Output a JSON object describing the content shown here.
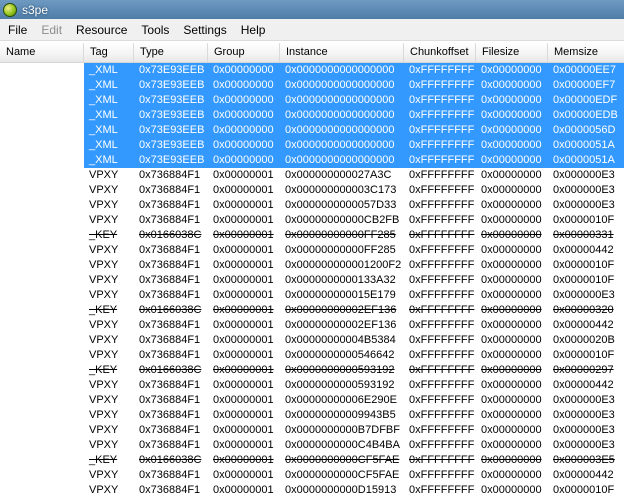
{
  "window": {
    "title": "s3pe",
    "icon": "app-globe-icon"
  },
  "menu": [
    {
      "label": "File",
      "enabled": true
    },
    {
      "label": "Edit",
      "enabled": false
    },
    {
      "label": "Resource",
      "enabled": true
    },
    {
      "label": "Tools",
      "enabled": true
    },
    {
      "label": "Settings",
      "enabled": true
    },
    {
      "label": "Help",
      "enabled": true
    }
  ],
  "columns": [
    "Name",
    "Tag",
    "Type",
    "Group",
    "Instance",
    "Chunkoffset",
    "Filesize",
    "Memsize"
  ],
  "rows": [
    {
      "name": "",
      "tag": "_XML",
      "type": "0x73E93EEB",
      "group": "0x00000000",
      "instance": "0x0000000000000000",
      "chunk": "0xFFFFFFFF",
      "filesize": "0x00000000",
      "memsize": "0x00000EE7",
      "selected": true,
      "deleted": false
    },
    {
      "name": "",
      "tag": "_XML",
      "type": "0x73E93EEB",
      "group": "0x00000000",
      "instance": "0x0000000000000000",
      "chunk": "0xFFFFFFFF",
      "filesize": "0x00000000",
      "memsize": "0x00000EF7",
      "selected": true,
      "deleted": false
    },
    {
      "name": "",
      "tag": "_XML",
      "type": "0x73E93EEB",
      "group": "0x00000000",
      "instance": "0x0000000000000000",
      "chunk": "0xFFFFFFFF",
      "filesize": "0x00000000",
      "memsize": "0x00000EDF",
      "selected": true,
      "deleted": false
    },
    {
      "name": "",
      "tag": "_XML",
      "type": "0x73E93EEB",
      "group": "0x00000000",
      "instance": "0x0000000000000000",
      "chunk": "0xFFFFFFFF",
      "filesize": "0x00000000",
      "memsize": "0x00000EDB",
      "selected": true,
      "deleted": false
    },
    {
      "name": "",
      "tag": "_XML",
      "type": "0x73E93EEB",
      "group": "0x00000000",
      "instance": "0x0000000000000000",
      "chunk": "0xFFFFFFFF",
      "filesize": "0x00000000",
      "memsize": "0x0000056D",
      "selected": true,
      "deleted": false
    },
    {
      "name": "",
      "tag": "_XML",
      "type": "0x73E93EEB",
      "group": "0x00000000",
      "instance": "0x0000000000000000",
      "chunk": "0xFFFFFFFF",
      "filesize": "0x00000000",
      "memsize": "0x0000051A",
      "selected": true,
      "deleted": false
    },
    {
      "name": "",
      "tag": "_XML",
      "type": "0x73E93EEB",
      "group": "0x00000000",
      "instance": "0x0000000000000000",
      "chunk": "0xFFFFFFFF",
      "filesize": "0x00000000",
      "memsize": "0x0000051A",
      "selected": true,
      "deleted": false
    },
    {
      "name": "",
      "tag": "VPXY",
      "type": "0x736884F1",
      "group": "0x00000001",
      "instance": "0x000000000027A3C",
      "chunk": "0xFFFFFFFF",
      "filesize": "0x00000000",
      "memsize": "0x000000E3",
      "selected": false,
      "deleted": false
    },
    {
      "name": "",
      "tag": "VPXY",
      "type": "0x736884F1",
      "group": "0x00000001",
      "instance": "0x000000000003C173",
      "chunk": "0xFFFFFFFF",
      "filesize": "0x00000000",
      "memsize": "0x000000E3",
      "selected": false,
      "deleted": false
    },
    {
      "name": "",
      "tag": "VPXY",
      "type": "0x736884F1",
      "group": "0x00000001",
      "instance": "0x0000000000057D33",
      "chunk": "0xFFFFFFFF",
      "filesize": "0x00000000",
      "memsize": "0x000000E3",
      "selected": false,
      "deleted": false
    },
    {
      "name": "",
      "tag": "VPXY",
      "type": "0x736884F1",
      "group": "0x00000001",
      "instance": "0x00000000000CB2FB",
      "chunk": "0xFFFFFFFF",
      "filesize": "0x00000000",
      "memsize": "0x0000010F",
      "selected": false,
      "deleted": false
    },
    {
      "name": "",
      "tag": "_KEY",
      "type": "0x0166038C",
      "group": "0x00000001",
      "instance": "0x00000000000FF285",
      "chunk": "0xFFFFFFFF",
      "filesize": "0x00000000",
      "memsize": "0x00000331",
      "selected": false,
      "deleted": true
    },
    {
      "name": "",
      "tag": "VPXY",
      "type": "0x736884F1",
      "group": "0x00000001",
      "instance": "0x00000000000FF285",
      "chunk": "0xFFFFFFFF",
      "filesize": "0x00000000",
      "memsize": "0x00000442",
      "selected": false,
      "deleted": false
    },
    {
      "name": "",
      "tag": "VPXY",
      "type": "0x736884F1",
      "group": "0x00000001",
      "instance": "0x000000000001200F2",
      "chunk": "0xFFFFFFFF",
      "filesize": "0x00000000",
      "memsize": "0x0000010F",
      "selected": false,
      "deleted": false
    },
    {
      "name": "",
      "tag": "VPXY",
      "type": "0x736884F1",
      "group": "0x00000001",
      "instance": "0x0000000000133A32",
      "chunk": "0xFFFFFFFF",
      "filesize": "0x00000000",
      "memsize": "0x0000010F",
      "selected": false,
      "deleted": false
    },
    {
      "name": "",
      "tag": "VPXY",
      "type": "0x736884F1",
      "group": "0x00000001",
      "instance": "0x000000000015E179",
      "chunk": "0xFFFFFFFF",
      "filesize": "0x00000000",
      "memsize": "0x000000E3",
      "selected": false,
      "deleted": false
    },
    {
      "name": "",
      "tag": "_KEY",
      "type": "0x0166038C",
      "group": "0x00000001",
      "instance": "0x00000000002EF136",
      "chunk": "0xFFFFFFFF",
      "filesize": "0x00000000",
      "memsize": "0x00000320",
      "selected": false,
      "deleted": true
    },
    {
      "name": "",
      "tag": "VPXY",
      "type": "0x736884F1",
      "group": "0x00000001",
      "instance": "0x00000000002EF136",
      "chunk": "0xFFFFFFFF",
      "filesize": "0x00000000",
      "memsize": "0x00000442",
      "selected": false,
      "deleted": false
    },
    {
      "name": "",
      "tag": "VPXY",
      "type": "0x736884F1",
      "group": "0x00000001",
      "instance": "0x00000000004B5384",
      "chunk": "0xFFFFFFFF",
      "filesize": "0x00000000",
      "memsize": "0x0000020B",
      "selected": false,
      "deleted": false
    },
    {
      "name": "",
      "tag": "VPXY",
      "type": "0x736884F1",
      "group": "0x00000001",
      "instance": "0x0000000000546642",
      "chunk": "0xFFFFFFFF",
      "filesize": "0x00000000",
      "memsize": "0x0000010F",
      "selected": false,
      "deleted": false
    },
    {
      "name": "",
      "tag": "_KEY",
      "type": "0x0166038C",
      "group": "0x00000001",
      "instance": "0x0000000000593192",
      "chunk": "0xFFFFFFFF",
      "filesize": "0x00000000",
      "memsize": "0x00000297",
      "selected": false,
      "deleted": true
    },
    {
      "name": "",
      "tag": "VPXY",
      "type": "0x736884F1",
      "group": "0x00000001",
      "instance": "0x0000000000593192",
      "chunk": "0xFFFFFFFF",
      "filesize": "0x00000000",
      "memsize": "0x00000442",
      "selected": false,
      "deleted": false
    },
    {
      "name": "",
      "tag": "VPXY",
      "type": "0x736884F1",
      "group": "0x00000001",
      "instance": "0x00000000006E290E",
      "chunk": "0xFFFFFFFF",
      "filesize": "0x00000000",
      "memsize": "0x000000E3",
      "selected": false,
      "deleted": false
    },
    {
      "name": "",
      "tag": "VPXY",
      "type": "0x736884F1",
      "group": "0x00000001",
      "instance": "0x00000000009943B5",
      "chunk": "0xFFFFFFFF",
      "filesize": "0x00000000",
      "memsize": "0x000000E3",
      "selected": false,
      "deleted": false
    },
    {
      "name": "",
      "tag": "VPXY",
      "type": "0x736884F1",
      "group": "0x00000001",
      "instance": "0x0000000000B7DFBF",
      "chunk": "0xFFFFFFFF",
      "filesize": "0x00000000",
      "memsize": "0x000000E3",
      "selected": false,
      "deleted": false
    },
    {
      "name": "",
      "tag": "VPXY",
      "type": "0x736884F1",
      "group": "0x00000001",
      "instance": "0x0000000000C4B4BA",
      "chunk": "0xFFFFFFFF",
      "filesize": "0x00000000",
      "memsize": "0x000000E3",
      "selected": false,
      "deleted": false
    },
    {
      "name": "",
      "tag": "_KEY",
      "type": "0x0166038C",
      "group": "0x00000001",
      "instance": "0x0000000000CF5FAE",
      "chunk": "0xFFFFFFFF",
      "filesize": "0x00000000",
      "memsize": "0x000003E5",
      "selected": false,
      "deleted": true
    },
    {
      "name": "",
      "tag": "VPXY",
      "type": "0x736884F1",
      "group": "0x00000001",
      "instance": "0x0000000000CF5FAE",
      "chunk": "0xFFFFFFFF",
      "filesize": "0x00000000",
      "memsize": "0x00000442",
      "selected": false,
      "deleted": false
    },
    {
      "name": "",
      "tag": "VPXY",
      "type": "0x736884F1",
      "group": "0x00000001",
      "instance": "0x0000000000D15913",
      "chunk": "0xFFFFFFFF",
      "filesize": "0x00000000",
      "memsize": "0x0000010F",
      "selected": false,
      "deleted": false
    }
  ],
  "colors": {
    "selection": "#3399ff",
    "titlebar": "#5f8bb5",
    "menubar": "#f0f0f0"
  }
}
